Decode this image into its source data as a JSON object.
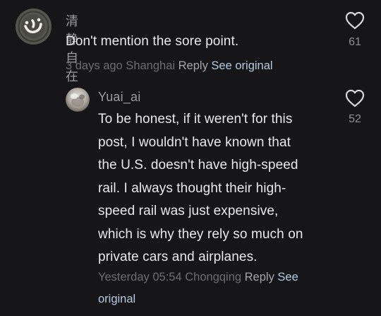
{
  "comments": [
    {
      "username": "清静自在",
      "text": "Don't mention the sore point.",
      "meta_time_location": "3 days ago Shanghai ",
      "reply_label": "Reply",
      "see_original_label": "See original",
      "like_count": "61",
      "avatar_icon": "heart-glyph-seal-avatar"
    },
    {
      "username": "Yuai_ai",
      "text_lines": [
        "To be honest, if it weren't for this",
        "post, I wouldn't have known that",
        "the U.S. doesn't have high-speed",
        "rail. I always thought their high-",
        "speed rail was just expensive,",
        "which is why they rely so much on",
        "private cars and airplanes."
      ],
      "meta_time_location": "Yesterday 05:54 Chongqing ",
      "reply_label": "Reply",
      "see_original_label_1": "See",
      "see_original_label_2": "original",
      "like_count": "52",
      "avatar_icon": "photo-avatar"
    }
  ],
  "colors": {
    "background": "#161618",
    "text_primary": "#e9e9ea",
    "text_secondary": "#9b9ba1",
    "link_see_original": "#b7c8e0"
  },
  "icons": [
    "heart-outline-icon"
  ]
}
